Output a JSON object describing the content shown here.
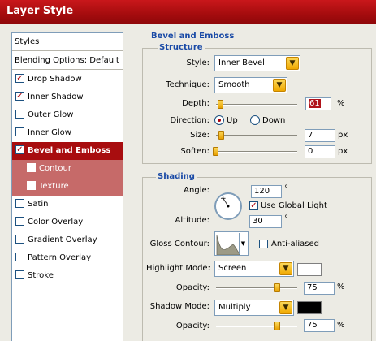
{
  "window": {
    "title": "Layer Style"
  },
  "styles_list": {
    "header": "Styles",
    "blending": "Blending Options: Default",
    "items": [
      {
        "label": "Drop Shadow",
        "checked": true
      },
      {
        "label": "Inner Shadow",
        "checked": true
      },
      {
        "label": "Outer Glow",
        "checked": false
      },
      {
        "label": "Inner Glow",
        "checked": false
      },
      {
        "label": "Bevel and Emboss",
        "checked": true,
        "selected": true
      },
      {
        "label": "Contour",
        "checked": false,
        "sub": true
      },
      {
        "label": "Texture",
        "checked": false,
        "sub": true
      },
      {
        "label": "Satin",
        "checked": false
      },
      {
        "label": "Color Overlay",
        "checked": false
      },
      {
        "label": "Gradient Overlay",
        "checked": false
      },
      {
        "label": "Pattern Overlay",
        "checked": false
      },
      {
        "label": "Stroke",
        "checked": false
      }
    ]
  },
  "bevel": {
    "group_title": "Bevel and Emboss",
    "structure_title": "Structure",
    "style_label": "Style:",
    "style_value": "Inner Bevel",
    "technique_label": "Technique:",
    "technique_value": "Smooth",
    "depth_label": "Depth:",
    "depth_value": "61",
    "depth_unit": "%",
    "direction_label": "Direction:",
    "dir_up": "Up",
    "dir_down": "Down",
    "size_label": "Size:",
    "size_value": "7",
    "size_unit": "px",
    "soften_label": "Soften:",
    "soften_value": "0",
    "soften_unit": "px"
  },
  "shading": {
    "title": "Shading",
    "angle_label": "Angle:",
    "angle_value": "120",
    "angle_unit": "°",
    "global_light": "Use Global Light",
    "altitude_label": "Altitude:",
    "altitude_value": "30",
    "altitude_unit": "°",
    "gloss_label": "Gloss Contour:",
    "anti_aliased": "Anti-aliased",
    "highlight_mode_label": "Highlight Mode:",
    "highlight_mode": "Screen",
    "highlight_color": "#ffffff",
    "highlight_opacity_label": "Opacity:",
    "highlight_opacity": "75",
    "opacity_unit": "%",
    "shadow_mode_label": "Shadow Mode:",
    "shadow_mode": "Multiply",
    "shadow_color": "#000000",
    "shadow_opacity_label": "Opacity:",
    "shadow_opacity": "75"
  },
  "colors": {
    "accent": "#a80d0f",
    "group_title": "#1a4aa6",
    "slider": "#f0a800"
  }
}
